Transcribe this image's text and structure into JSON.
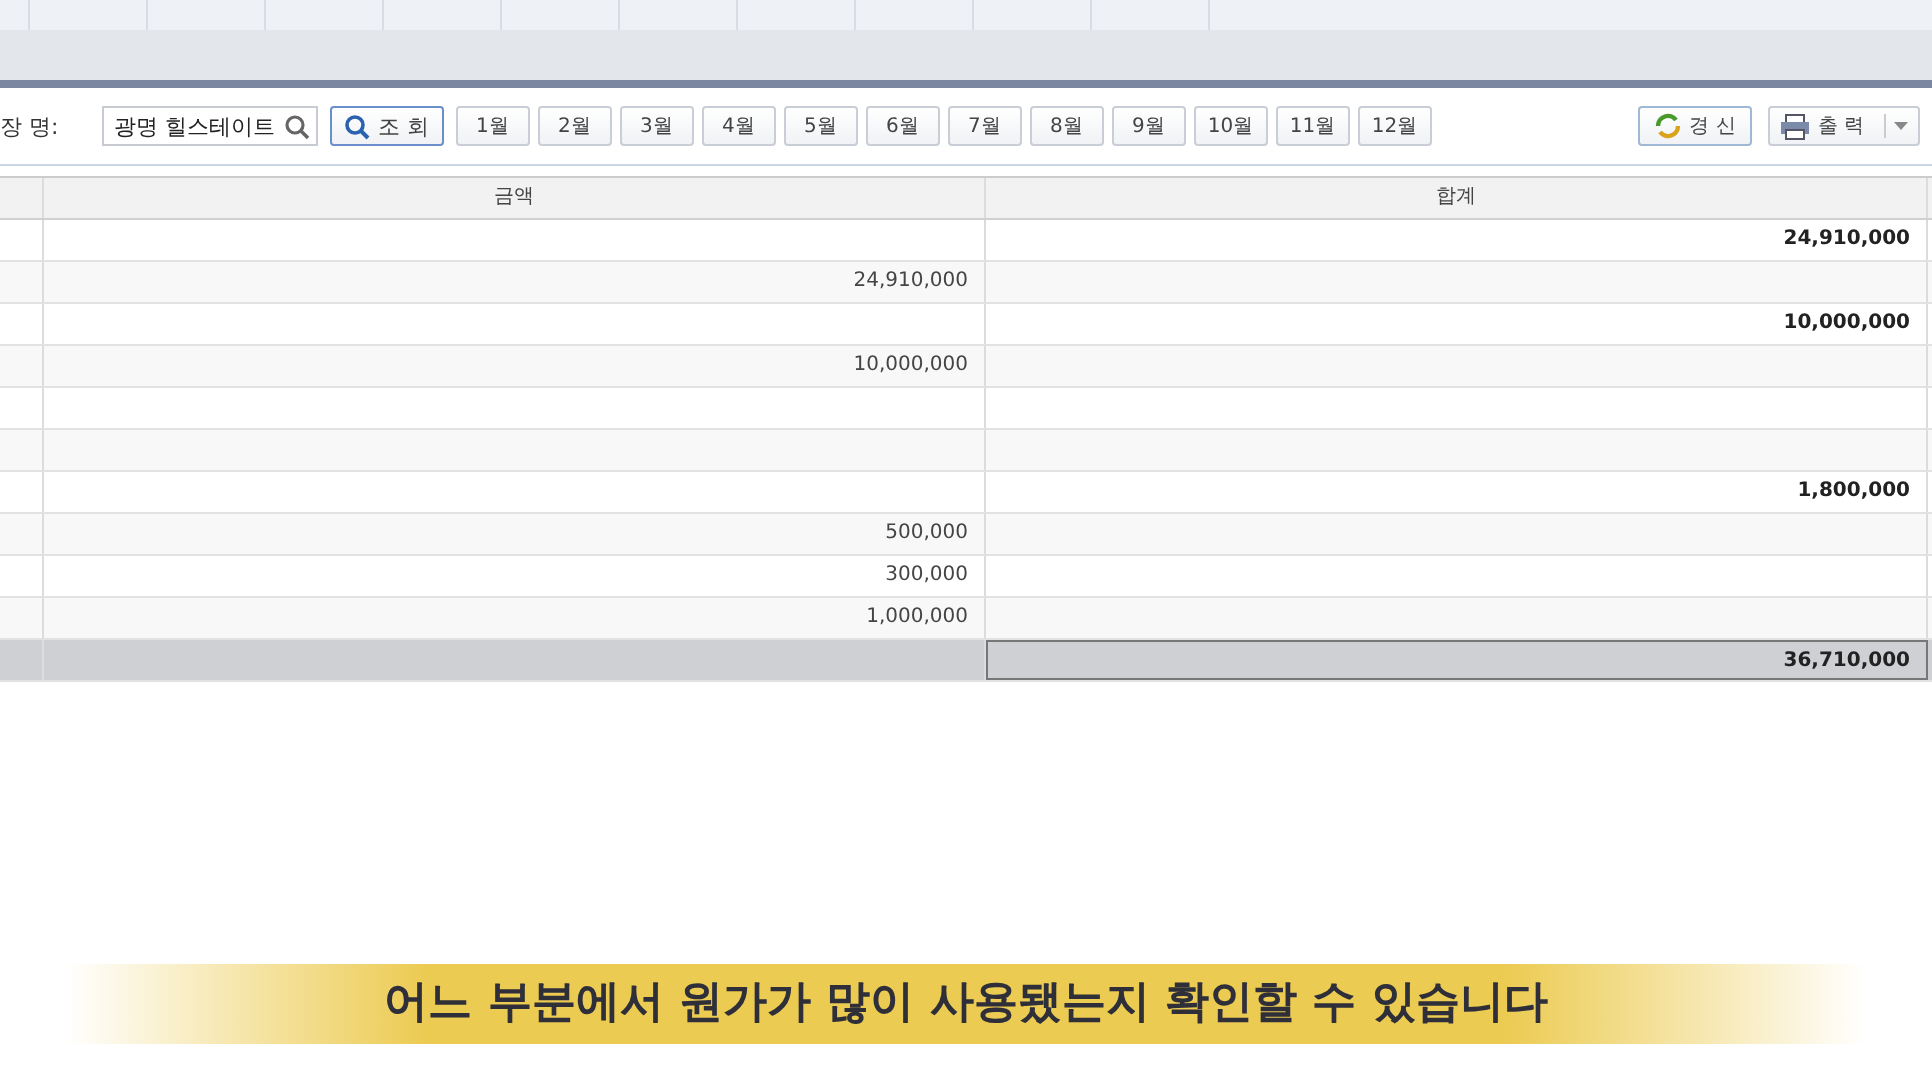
{
  "toolbar": {
    "site_label": "장 명:",
    "site_field": {
      "value": "광명 힐스테이트"
    },
    "search_button": "조 회",
    "months": [
      "1월",
      "2월",
      "3월",
      "4월",
      "5월",
      "6월",
      "7월",
      "8월",
      "9월",
      "10월",
      "11월",
      "12월"
    ],
    "refresh_button": "경 신",
    "print_button": "출 력"
  },
  "table": {
    "columns": [
      "",
      "금액",
      "합계"
    ],
    "rows": [
      {
        "amount": "",
        "total": "24,910,000"
      },
      {
        "amount": "24,910,000",
        "total": ""
      },
      {
        "amount": "",
        "total": "10,000,000"
      },
      {
        "amount": "10,000,000",
        "total": ""
      },
      {
        "amount": "",
        "total": ""
      },
      {
        "amount": "",
        "total": ""
      },
      {
        "amount": "",
        "total": "1,800,000"
      },
      {
        "amount": "500,000",
        "total": ""
      },
      {
        "amount": "300,000",
        "total": ""
      },
      {
        "amount": "1,000,000",
        "total": ""
      }
    ],
    "footer": {
      "total": "36,710,000"
    }
  },
  "caption": "어느 부분에서 원가가 많이 사용됐는지 확인할 수 있습니다"
}
